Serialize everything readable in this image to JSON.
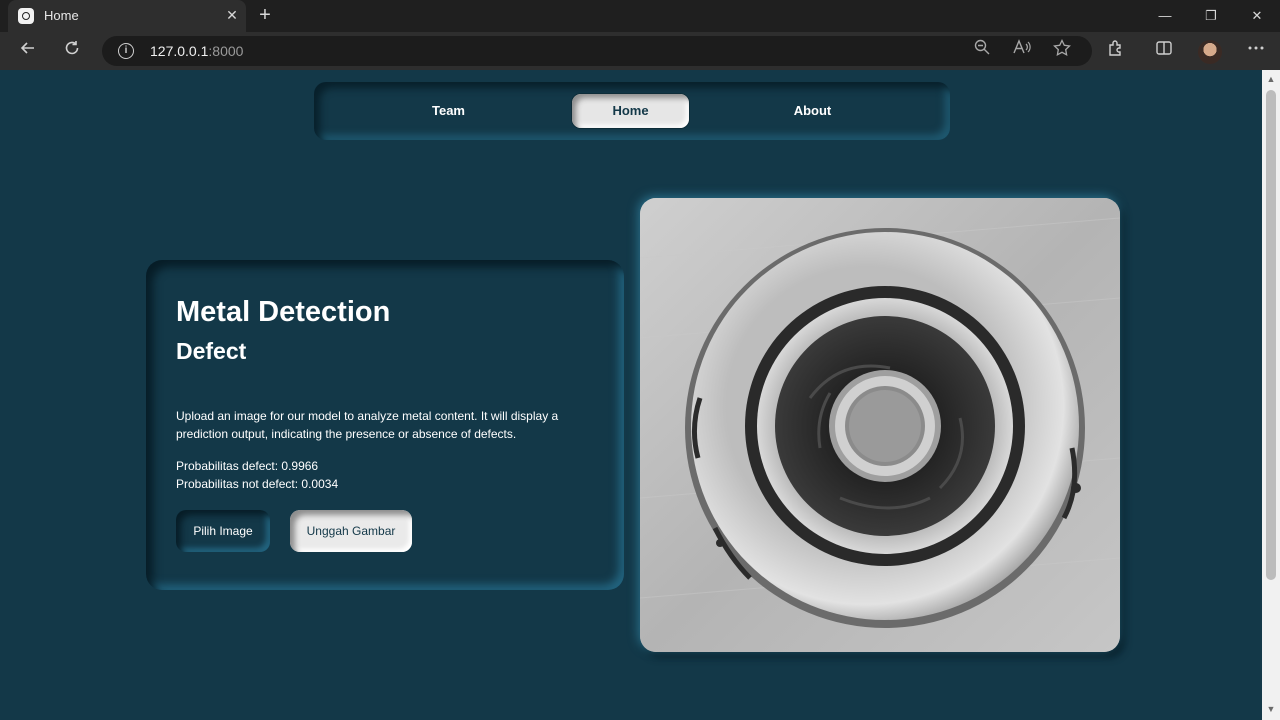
{
  "browser": {
    "tab_title": "Home",
    "tab_close": "✕",
    "new_tab": "+",
    "address_host": "127.0.0.1",
    "address_port": ":8000",
    "window_controls": {
      "minimize": "—",
      "restore": "❐",
      "close": "✕"
    },
    "icons": {
      "back": "back-arrow-icon",
      "reload": "reload-icon",
      "info": "info-icon",
      "zoom": "zoom-out-icon",
      "read_aloud": "read-aloud-icon",
      "favorite": "star-icon",
      "extensions": "extensions-icon",
      "split": "split-screen-icon",
      "more": "more-icon"
    }
  },
  "nav": {
    "items": [
      {
        "label": "Team",
        "active": false
      },
      {
        "label": "Home",
        "active": true
      },
      {
        "label": "About",
        "active": false
      }
    ]
  },
  "card": {
    "title": "Metal Detection",
    "subtitle": "Defect",
    "description": "Upload an image for our model to analyze metal content. It will display a prediction output, indicating the presence or absence of defects.",
    "prob_defect": "Probabilitas defect: 0.9966",
    "prob_not_defect": "Probabilitas not defect: 0.0034",
    "pick_button": "Pilih Image",
    "upload_button": "Unggah Gambar"
  },
  "colors": {
    "page_bg": "#133848",
    "button_light": "#eaeaea",
    "text": "#ffffff"
  }
}
